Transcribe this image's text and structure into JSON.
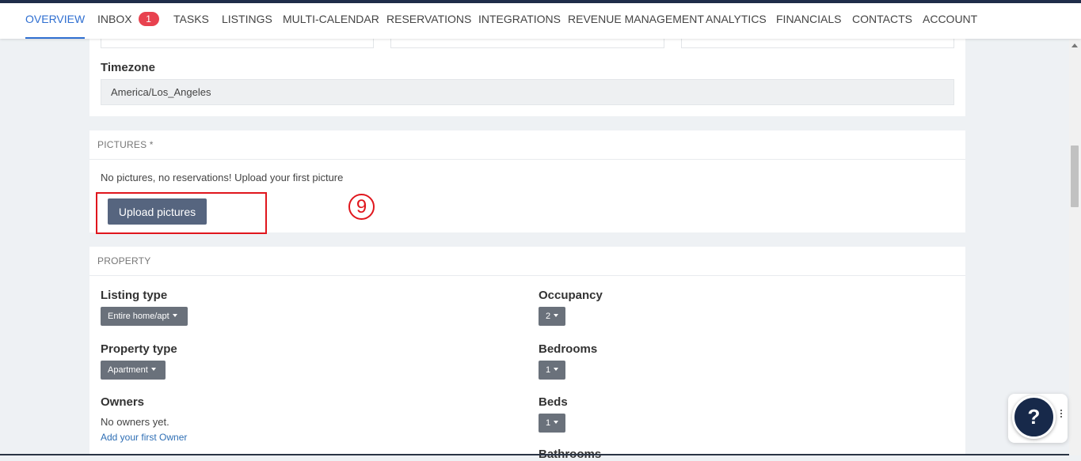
{
  "nav": {
    "items": [
      {
        "label": "OVERVIEW",
        "active": true
      },
      {
        "label": "INBOX",
        "badge": "1"
      },
      {
        "label": "TASKS"
      },
      {
        "label": "LISTINGS"
      },
      {
        "label": "MULTI-CALENDAR"
      },
      {
        "label": "RESERVATIONS"
      },
      {
        "label": "INTEGRATIONS"
      },
      {
        "label": "REVENUE MANAGEMENT"
      },
      {
        "label": "ANALYTICS"
      },
      {
        "label": "FINANCIALS"
      },
      {
        "label": "CONTACTS"
      },
      {
        "label": "ACCOUNT"
      }
    ]
  },
  "location": {
    "timezone_label": "Timezone",
    "timezone_value": "America/Los_Angeles"
  },
  "pictures": {
    "header": "PICTURES *",
    "empty_text": "No pictures, no reservations! Upload your first picture",
    "upload_label": "Upload pictures",
    "step_marker": "9"
  },
  "property": {
    "header": "PROPERTY",
    "listing_type": {
      "label": "Listing type",
      "value": "Entire home/apt"
    },
    "property_type": {
      "label": "Property type",
      "value": "Apartment"
    },
    "owners": {
      "label": "Owners",
      "empty": "No owners yet.",
      "add_link": "Add your first Owner"
    },
    "occupancy": {
      "label": "Occupancy",
      "value": "2"
    },
    "bedrooms": {
      "label": "Bedrooms",
      "value": "1"
    },
    "beds": {
      "label": "Beds",
      "value": "1"
    },
    "bathrooms": {
      "label": "Bathrooms"
    }
  },
  "help": {
    "icon": "question-icon",
    "symbol": "?"
  },
  "colors": {
    "accent": "#2f6fd1",
    "button": "#56657f",
    "highlight": "#e0161d",
    "navy": "#17294a"
  }
}
